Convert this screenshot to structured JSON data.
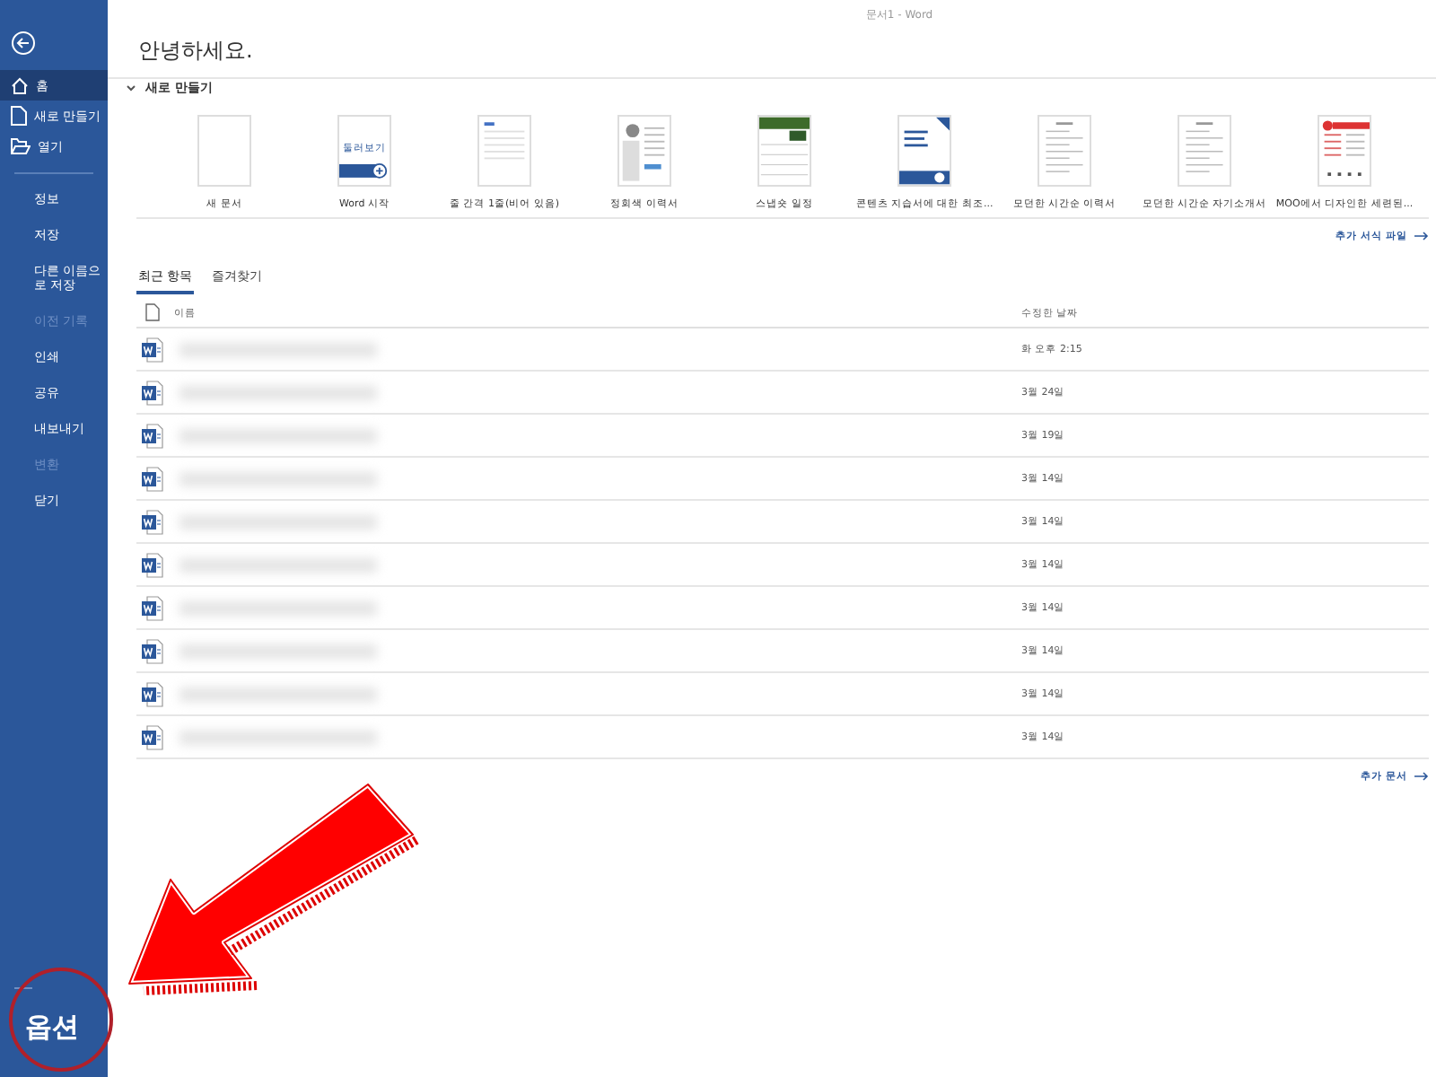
{
  "window": {
    "title": "문서1 - Word"
  },
  "sidebar": {
    "nav": [
      {
        "label": "홈",
        "kind": "home",
        "selected": true
      },
      {
        "label": "새로 만들기",
        "kind": "new",
        "selected": false
      },
      {
        "label": "열기",
        "kind": "open",
        "selected": false
      }
    ],
    "items": [
      {
        "label": "정보",
        "disabled": false
      },
      {
        "label": "저장",
        "disabled": false
      },
      {
        "label": "다른 이름으로 저장",
        "disabled": false
      },
      {
        "label": "이전 기록",
        "disabled": true
      },
      {
        "label": "인쇄",
        "disabled": false
      },
      {
        "label": "공유",
        "disabled": false
      },
      {
        "label": "내보내기",
        "disabled": false
      },
      {
        "label": "변환",
        "disabled": true
      },
      {
        "label": "닫기",
        "disabled": false
      }
    ],
    "footer": "옵션"
  },
  "greeting": "안녕하세요.",
  "new_section": {
    "title": "새로 만들기",
    "expanded": true,
    "templates": [
      {
        "label": "새 문서",
        "kind": "blank"
      },
      {
        "label": "Word 시작",
        "kind": "tour",
        "thumb_text": "둘러보기"
      },
      {
        "label": "줄 간격 1줄(비어 있음)",
        "kind": "lines"
      },
      {
        "label": "정회색 이력서",
        "kind": "resume"
      },
      {
        "label": "스냅숏 일정",
        "kind": "calendar"
      },
      {
        "label": "콘텐츠 지습서에 대한 최조...",
        "kind": "cover"
      },
      {
        "label": "모던한 시간순 이력서",
        "kind": "list"
      },
      {
        "label": "모던한 시간순 자기소개서",
        "kind": "list"
      },
      {
        "label": "MOO에서 디자인한 세련된...",
        "kind": "red"
      }
    ],
    "more": "추가 서식 파일"
  },
  "tabs": [
    {
      "label": "최근 항목",
      "selected": true
    },
    {
      "label": "즐겨찾기",
      "selected": false
    }
  ],
  "table": {
    "columns": [
      "이름",
      "수정한 날짜"
    ],
    "rows": [
      {
        "date": "화 오후 2:15"
      },
      {
        "date": "3월 24일"
      },
      {
        "date": "3월 19일"
      },
      {
        "date": "3월 14일"
      },
      {
        "date": "3월 14일"
      },
      {
        "date": "3월 14일"
      },
      {
        "date": "3월 14일"
      },
      {
        "date": "3월 14일"
      },
      {
        "date": "3월 14일"
      },
      {
        "date": "3월 14일"
      }
    ]
  },
  "more_docs": "추가 문서"
}
